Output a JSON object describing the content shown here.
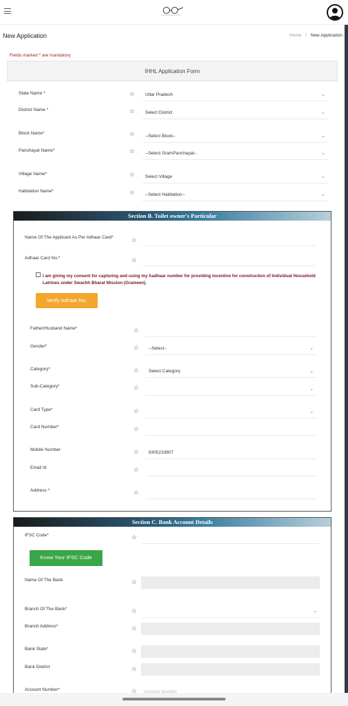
{
  "header": {
    "page_title": "New Application",
    "breadcrumb_home": "Home",
    "breadcrumb_sep": "/",
    "breadcrumb_current": "New Application"
  },
  "form": {
    "mandatory_note": "Fields marked * are mandatory",
    "title": "IHHL Application Form",
    "location": {
      "state_label": "State Name *",
      "state_value": "Uttar Pradesh",
      "district_label": "District Name *",
      "district_value": "Select District",
      "block_label": "Block Name*",
      "block_value": "--Select Block--",
      "panchayat_label": "Panchayat Name*",
      "panchayat_value": "--Select GramPanchayat--",
      "village_label": "Village Name*",
      "village_value": "Select Village",
      "habitation_label": "Habitation Name*",
      "habitation_value": "--Select Habitation--"
    }
  },
  "section_b": {
    "title": "Section B. Toilet owner's Particular",
    "applicant_name_label": "Name Of The Applicant As Per Adhaar Card*",
    "adhaar_label": "Adhaar Card No.*",
    "consent_text": "I am giving my consent for capturing and using my Aadhaar number for providing incentive for construction of Individual Household Latrines under Swachh Bharat Mission (Grameen).",
    "verify_button": "Verify Adhaar No.",
    "father_label": "Father/Husband Name*",
    "gender_label": "Gender*",
    "gender_value": "--Select--",
    "category_label": "Category*",
    "category_value": "Select Category",
    "subcategory_label": "Sub-Category*",
    "cardtype_label": "Card Type*",
    "cardnumber_label": "Card Number*",
    "mobile_label": "Mobile Number",
    "mobile_value": "9305233807",
    "email_label": "Email Id",
    "address_label": "Address *"
  },
  "section_c": {
    "title": "Section C. Bank Account Details",
    "ifsc_label": "IFSC Code*",
    "ifsc_button": "Know Your IFSC Code",
    "bank_name_label": "Name Of The Bank",
    "branch_label": "Branch Of The Bank*",
    "branch_address_label": "Branch Address*",
    "bank_state_label": "Bank State*",
    "bank_district_label": "Bank District",
    "account_number_label": "Account Number*",
    "account_number_placeholder": "Account Number"
  },
  "icons": {
    "star": "☆",
    "chevron": "⌄"
  }
}
